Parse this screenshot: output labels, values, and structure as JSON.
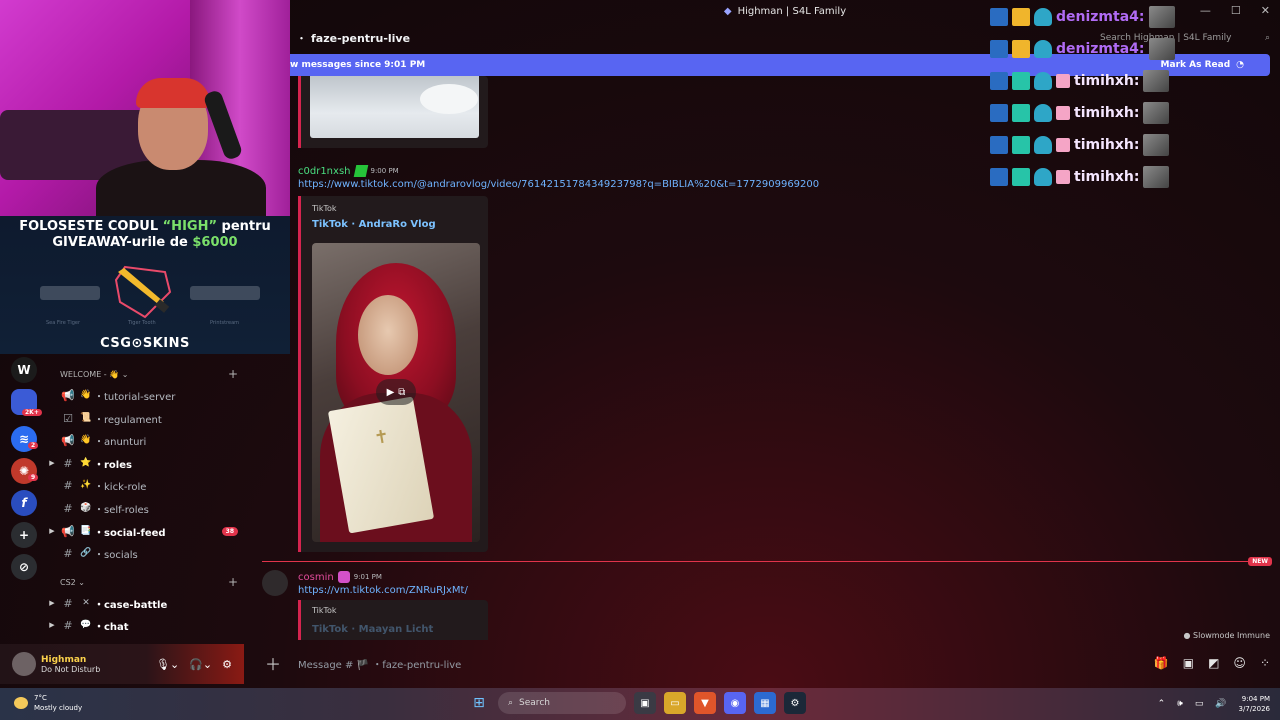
{
  "window": {
    "title": "Highman | S4L Family"
  },
  "channel": {
    "name": "faze-pentru-live",
    "search_placeholder": "Search Highman | S4L Family"
  },
  "new_messages_bar": {
    "text": "w messages since 9:01 PM",
    "action": "Mark As Read"
  },
  "messages": [
    {
      "author": "c0dr1nxsh",
      "time": "9:00 PM",
      "link": "https://www.tiktok.com/@andrarovlog/video/7614215178434923798?q=BIBLIA%20&t=1772909969200",
      "embed_provider": "TikTok",
      "embed_title": "TikTok · AndraRo Vlog"
    },
    {
      "author": "cosmin",
      "time": "9:01 PM",
      "link": "https://vm.tiktok.com/ZNRuRJxMt/",
      "embed_provider": "TikTok",
      "embed_title": "TikTok · Maayan Licht"
    }
  ],
  "new_label": "NEW",
  "slowmode": "Slowmode Immune",
  "message_input": {
    "placeholder": "Message # 🏴 ・faze-pentru-live"
  },
  "stream_overlay": {
    "promo_line1_a": "FOLOSESTE CODUL ",
    "promo_line1_code": "“HIGH”",
    "promo_line1_b": " pentru",
    "promo_line2_a": "GIVEAWAY-urile de ",
    "promo_line2_amount": "$6000",
    "brand": "CSG⊙SKINS",
    "skin_labels": [
      "Sea Fire Tiger",
      "Tiger Tooth",
      "Printstream"
    ]
  },
  "servers": [
    {
      "label": "W",
      "color": "#1b1b1b"
    },
    {
      "label": "",
      "color": "#3b5bd6",
      "badge": "2K+"
    },
    {
      "label": "",
      "color": "#2b6cf0",
      "badge": "2"
    },
    {
      "label": "",
      "color": "#c0392b",
      "badge": "9"
    },
    {
      "label": "f",
      "color": "#2a4dbf"
    },
    {
      "label": "+",
      "color": "#2b2d31"
    },
    {
      "label": "⊘",
      "color": "#2b2d31"
    }
  ],
  "categories": [
    {
      "name": "WELCOME - 👋"
    },
    {
      "name": "CS2"
    }
  ],
  "channels": [
    {
      "icon": "📢",
      "emoji": "👋",
      "label": "tutorial-server",
      "bold": false,
      "arrow": ""
    },
    {
      "icon": "☑",
      "emoji": "📜",
      "label": "regulament",
      "bold": false,
      "arrow": ""
    },
    {
      "icon": "📢",
      "emoji": "👋",
      "label": "anunturi",
      "bold": false,
      "arrow": ""
    },
    {
      "icon": "#",
      "emoji": "⭐",
      "label": "roles",
      "bold": true,
      "arrow": "▶"
    },
    {
      "icon": "#",
      "emoji": "✨",
      "label": "kick-role",
      "bold": false,
      "arrow": ""
    },
    {
      "icon": "#",
      "emoji": "🎲",
      "label": "self-roles",
      "bold": false,
      "arrow": ""
    },
    {
      "icon": "📢",
      "emoji": "📑",
      "label": "social-feed",
      "bold": true,
      "arrow": "▶",
      "count": "38"
    },
    {
      "icon": "#",
      "emoji": "🔗",
      "label": "socials",
      "bold": false,
      "arrow": ""
    },
    {
      "icon": "#",
      "emoji": "✕",
      "label": "case-battle",
      "bold": true,
      "arrow": "▶"
    },
    {
      "icon": "#",
      "emoji": "💬",
      "label": "chat",
      "bold": true,
      "arrow": "▶"
    }
  ],
  "user": {
    "name": "Highman",
    "status": "Do Not Disturb"
  },
  "chat_overlay": [
    {
      "badges": [
        "hammer",
        "crown",
        "ghost"
      ],
      "name": "denizmta4:",
      "color": "purple"
    },
    {
      "badges": [
        "hammer",
        "crown",
        "ghost"
      ],
      "name": "denizmta4:",
      "color": "purple"
    },
    {
      "badges": [
        "hammer",
        "bg",
        "ghost",
        "gift"
      ],
      "name": "timihxh:",
      "color": "white"
    },
    {
      "badges": [
        "hammer",
        "bg",
        "ghost",
        "gift"
      ],
      "name": "timihxh:",
      "color": "white"
    },
    {
      "badges": [
        "hammer",
        "bg",
        "ghost",
        "gift"
      ],
      "name": "timihxh:",
      "color": "white"
    },
    {
      "badges": [
        "hammer",
        "bg",
        "ghost",
        "gift"
      ],
      "name": "timihxh:",
      "color": "white"
    }
  ],
  "taskbar": {
    "temp": "7°C",
    "weather": "Mostly cloudy",
    "search": "Search",
    "time": "9:04 PM",
    "date": "3/7/2026"
  }
}
